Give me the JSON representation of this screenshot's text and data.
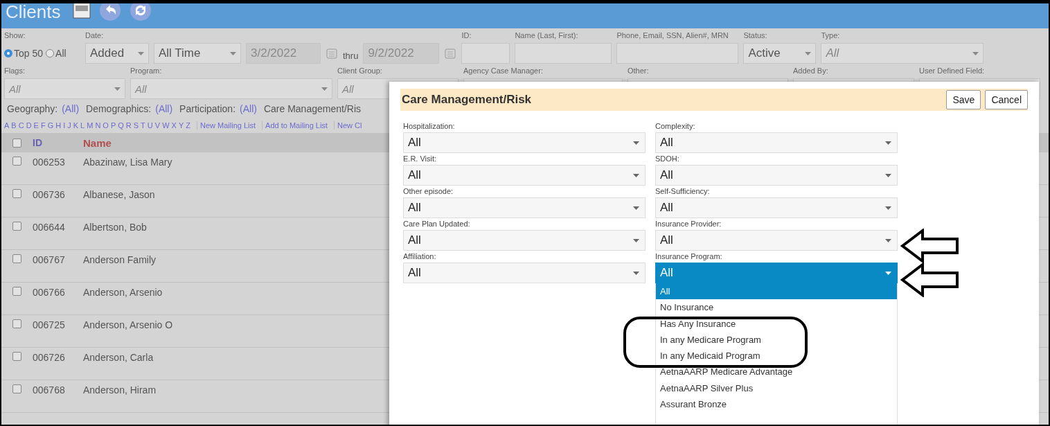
{
  "header": {
    "title": "Clients"
  },
  "filters": {
    "show": {
      "label": "Show:",
      "options": [
        {
          "label": "Top 50",
          "selected": true
        },
        {
          "label": "All",
          "selected": false
        }
      ]
    },
    "date": {
      "label": "Date:",
      "type": "Added",
      "range": "All Time",
      "from": "3/2/2022",
      "thru": "thru",
      "to": "9/2/2022"
    },
    "row1": [
      {
        "label": "ID:",
        "kind": "text"
      },
      {
        "label": "Name (Last, First):",
        "kind": "text"
      },
      {
        "label": "Phone, Email, SSN, Alien#, MRN",
        "kind": "text"
      },
      {
        "label": "Status:",
        "kind": "select",
        "value": "Active"
      },
      {
        "label": "Type:",
        "kind": "select",
        "placeholder": "All"
      }
    ],
    "row2": [
      {
        "label": "Flags:",
        "kind": "select",
        "placeholder": "All"
      },
      {
        "label": "Program:",
        "kind": "select",
        "placeholder": "All"
      },
      {
        "label": "Client Group:",
        "kind": "select",
        "placeholder": "All"
      },
      {
        "label": "Agency Case Manager:",
        "kind": "select"
      },
      {
        "label": "Other:",
        "kind": "select"
      },
      {
        "label": "Added By:",
        "kind": "select"
      },
      {
        "label": "User Defined Field:",
        "kind": "select"
      }
    ]
  },
  "categories": [
    {
      "label": "Geography:",
      "value": "(All)"
    },
    {
      "label": "Demographics:",
      "value": "(All)"
    },
    {
      "label": "Participation:",
      "value": "(All)"
    },
    {
      "label": "Care Management/Ris"
    }
  ],
  "letters": [
    "A",
    "B",
    "C",
    "D",
    "E",
    "F",
    "G",
    "H",
    "I",
    "J",
    "K",
    "L",
    "M",
    "N",
    "O",
    "P",
    "Q",
    "R",
    "S",
    "T",
    "U",
    "V",
    "W",
    "X",
    "Y",
    "Z"
  ],
  "actions": [
    "New Mailing List",
    "Add to Mailing List",
    "New Cl"
  ],
  "table": {
    "all_checked": false,
    "columns": [
      "ID",
      "Name"
    ],
    "rows": [
      {
        "id": "006253",
        "name": "Abazinaw, Lisa Mary",
        "checked": false
      },
      {
        "id": "006736",
        "name": "Albanese, Jason",
        "checked": false
      },
      {
        "id": "006644",
        "name": "Albertson, Bob",
        "checked": false
      },
      {
        "id": "006767",
        "name": "Anderson Family",
        "checked": false
      },
      {
        "id": "006766",
        "name": "Anderson, Arsenio",
        "checked": false
      },
      {
        "id": "006725",
        "name": "Anderson, Arsenio O",
        "checked": false
      },
      {
        "id": "006726",
        "name": "Anderson, Carla",
        "checked": false
      },
      {
        "id": "006768",
        "name": "Anderson, Hiram",
        "checked": false
      }
    ]
  },
  "modal": {
    "title": "Care Management/Risk",
    "buttons": [
      "Save",
      "Cancel"
    ],
    "fields": [
      {
        "label": "Hospitalization:",
        "value": "All",
        "open": false
      },
      {
        "label": "Complexity:",
        "value": "All",
        "open": false
      },
      {
        "label": "E.R. Visit:",
        "value": "All",
        "open": false
      },
      {
        "label": "SDOH:",
        "value": "All",
        "open": false
      },
      {
        "label": "Other episode:",
        "value": "All",
        "open": false
      },
      {
        "label": "Self-Sufficiency:",
        "value": "All",
        "open": false
      },
      {
        "label": "Care Plan Updated:",
        "value": "All",
        "open": false
      },
      {
        "label": "Insurance Provider:",
        "value": "All",
        "open": false
      },
      {
        "label": "Affiliation:",
        "value": "All",
        "open": false
      },
      {
        "label": "Insurance Program:",
        "value": "All",
        "open": true,
        "options": [
          {
            "label": "All",
            "selected": true
          },
          {
            "label": "No Insurance",
            "selected": false
          },
          {
            "label": "Has Any Insurance",
            "selected": false
          },
          {
            "label": "In any Medicare Program",
            "selected": false
          },
          {
            "label": "In any Medicaid Program",
            "selected": false
          },
          {
            "label": "AetnaAARP Medicare Advantage",
            "selected": false
          },
          {
            "label": "AetnaAARP Silver Plus",
            "selected": false
          },
          {
            "label": "Assurant Bronze",
            "selected": false
          }
        ]
      }
    ]
  }
}
